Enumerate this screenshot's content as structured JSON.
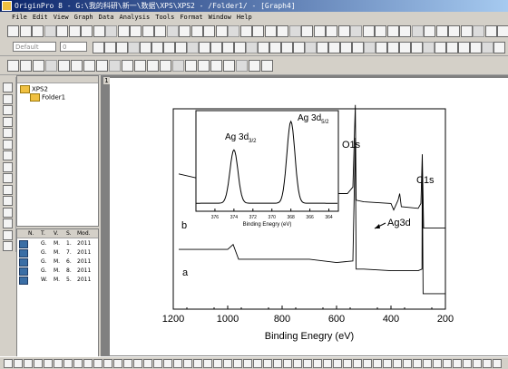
{
  "window": {
    "title": "OriginPro 8 - G:\\我的科研\\新一\\数据\\XPS\\XPS2 - /Folder1/ - [Graph4]"
  },
  "menu": [
    "File",
    "Edit",
    "View",
    "Graph",
    "Data",
    "Analysis",
    "Tools",
    "Format",
    "Window",
    "Help"
  ],
  "toolbar": {
    "font_combo": "Default",
    "size_combo": "0"
  },
  "explorer": {
    "root": "XPS2",
    "child": "Folder1"
  },
  "filelist": {
    "columns": [
      "N.",
      "T.",
      "V.",
      "S.",
      "Mod."
    ],
    "rows": [
      [
        "G.",
        "M.",
        "1.",
        "2011"
      ],
      [
        "G.",
        "M.",
        "7.",
        "2011"
      ],
      [
        "G.",
        "M.",
        "6.",
        "2011"
      ],
      [
        "G.",
        "M.",
        "8.",
        "2011"
      ],
      [
        "W.",
        "M.",
        "5.",
        "2011"
      ]
    ]
  },
  "graph": {
    "tab_number": "1"
  },
  "chart_data": {
    "type": "line",
    "xlabel": "Binding Enegry (eV)",
    "ylabel": "",
    "xlim": [
      1200,
      200
    ],
    "x_ticks": [
      "1200",
      "1000",
      "800",
      "600",
      "400",
      "200"
    ],
    "series": [
      {
        "name": "b",
        "points": [
          [
            1180,
            0.78
          ],
          [
            1100,
            0.75
          ],
          [
            1000,
            0.75
          ],
          [
            980,
            0.8
          ],
          [
            960,
            0.7
          ],
          [
            900,
            0.7
          ],
          [
            800,
            0.69
          ],
          [
            700,
            0.7
          ],
          [
            640,
            0.68
          ],
          [
            600,
            0.66
          ],
          [
            560,
            0.66
          ],
          [
            540,
            0.7
          ],
          [
            531,
            1.2
          ],
          [
            528,
            0.62
          ],
          [
            500,
            0.61
          ],
          [
            400,
            0.6
          ],
          [
            390,
            0.56
          ],
          [
            374,
            0.62
          ],
          [
            368,
            0.66
          ],
          [
            362,
            0.58
          ],
          [
            300,
            0.57
          ],
          [
            290,
            0.6
          ],
          [
            285,
            0.9
          ],
          [
            280,
            0.45
          ],
          [
            200,
            0.45
          ]
        ]
      },
      {
        "name": "a",
        "points": [
          [
            1180,
            0.32
          ],
          [
            1100,
            0.32
          ],
          [
            1000,
            0.32
          ],
          [
            980,
            0.35
          ],
          [
            960,
            0.26
          ],
          [
            900,
            0.26
          ],
          [
            800,
            0.26
          ],
          [
            700,
            0.26
          ],
          [
            600,
            0.24
          ],
          [
            540,
            0.25
          ],
          [
            531,
            1.0
          ],
          [
            528,
            0.2
          ],
          [
            500,
            0.2
          ],
          [
            400,
            0.19
          ],
          [
            300,
            0.19
          ],
          [
            286,
            0.2
          ],
          [
            285,
            0.85
          ],
          [
            282,
            0.05
          ],
          [
            200,
            0.05
          ]
        ]
      }
    ],
    "annotations": [
      "O1s",
      "C1s",
      "Ag3d",
      "a",
      "b"
    ],
    "inset": {
      "xlabel": "Binding Enegry (eV)",
      "x_ticks": [
        "376",
        "374",
        "372",
        "370",
        "368",
        "366",
        "364"
      ],
      "xlim": [
        378,
        363
      ],
      "peaks": [
        {
          "label": "Ag 3d",
          "subscript": "3/2",
          "x": 374.0,
          "height": 0.62
        },
        {
          "label": "Ag 3d",
          "subscript": "5/2",
          "x": 368.0,
          "height": 0.95
        }
      ]
    }
  }
}
